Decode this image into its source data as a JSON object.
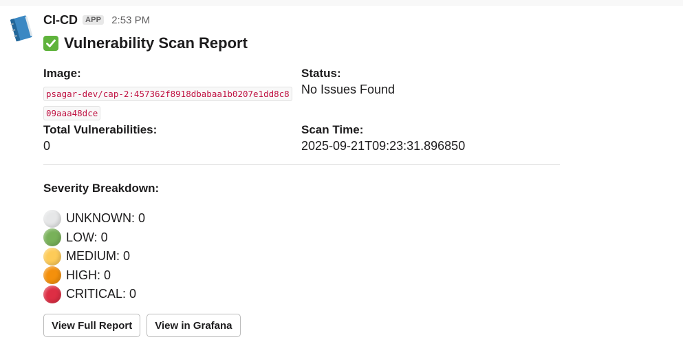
{
  "message": {
    "sender": "CI-CD",
    "badge": "APP",
    "time": "2:53 PM",
    "avatar_icon": "notebook-icon"
  },
  "report": {
    "title_emoji": "white-check-mark-icon",
    "title": "Vulnerability Scan Report",
    "fields": {
      "image_label": "Image:",
      "image_value": "psagar-dev/cap-2:457362f8918dbabaa1b0207e1dd8c809aaa48dce",
      "status_label": "Status:",
      "status_value": "No Issues Found",
      "total_label": "Total Vulnerabilities:",
      "total_value": "0",
      "scan_label": "Scan Time:",
      "scan_value": "2025-09-21T09:23:31.896850"
    },
    "severity_label": "Severity Breakdown:",
    "severities": [
      {
        "text": "UNKNOWN: 0",
        "color": "#e6e7e8",
        "icon": "white-circle-icon"
      },
      {
        "text": "LOW: 0",
        "color": "#78b159",
        "icon": "green-circle-icon"
      },
      {
        "text": "MEDIUM: 0",
        "color": "#fdcb58",
        "icon": "yellow-circle-icon"
      },
      {
        "text": "HIGH: 0",
        "color": "#f4900c",
        "icon": "orange-circle-icon"
      },
      {
        "text": "CRITICAL: 0",
        "color": "#dd2e44",
        "icon": "red-circle-icon"
      }
    ],
    "buttons": {
      "full_report": "View Full Report",
      "grafana": "View in Grafana"
    }
  }
}
